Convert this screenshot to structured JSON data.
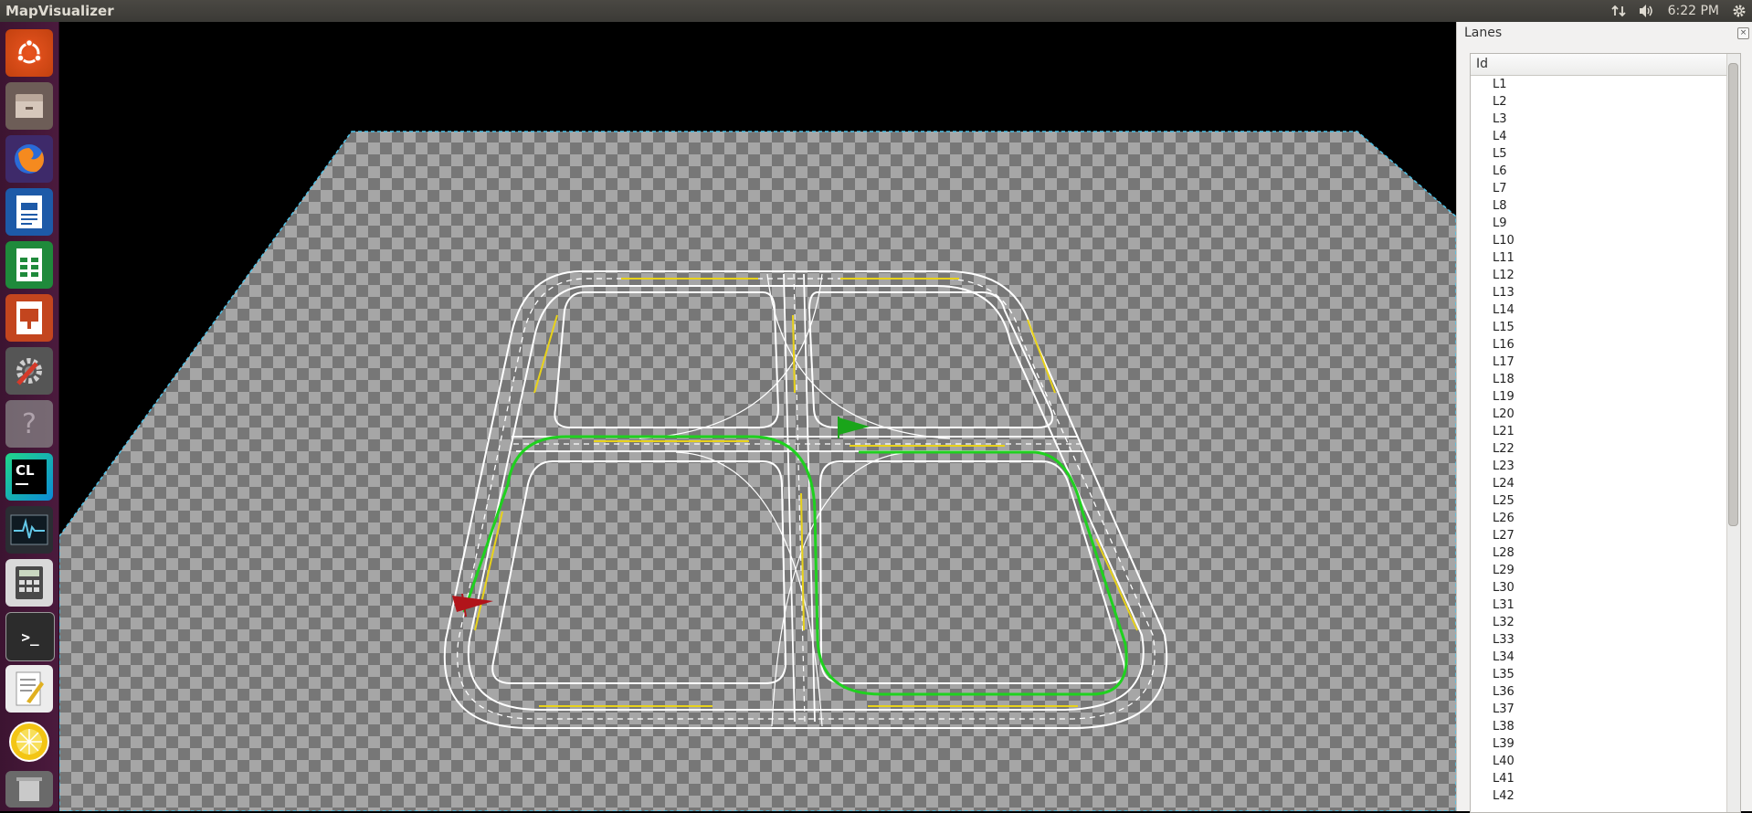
{
  "app": {
    "title": "MapVisualizer"
  },
  "tray": {
    "network_icon": "network-updown-icon",
    "volume_icon": "volume-icon",
    "time": "6:22 PM",
    "settings_icon": "gear-icon"
  },
  "launcher": {
    "items": [
      {
        "name": "ubuntu-dash-icon"
      },
      {
        "name": "files-icon"
      },
      {
        "name": "firefox-icon"
      },
      {
        "name": "writer-icon"
      },
      {
        "name": "calc-icon"
      },
      {
        "name": "impress-icon"
      },
      {
        "name": "system-settings-icon"
      },
      {
        "name": "help-icon"
      },
      {
        "name": "clion-icon",
        "label": "CL"
      },
      {
        "name": "system-monitor-icon"
      },
      {
        "name": "calculator-icon"
      },
      {
        "name": "terminal-icon",
        "label": ">_"
      },
      {
        "name": "text-editor-icon"
      },
      {
        "name": "lemon-app-icon"
      },
      {
        "name": "trash-icon"
      }
    ]
  },
  "colors": {
    "road": "#ffffff",
    "center_line": "#e8d21a",
    "route": "#1fd11f",
    "start_flag": "#1aa51a",
    "end_flag": "#b1141a",
    "checker_light": "#a6a6a6",
    "checker_dark": "#777777",
    "grid_edge": "#4fc3e8"
  },
  "panel": {
    "title": "Lanes",
    "column": "Id",
    "lanes": [
      "L1",
      "L2",
      "L3",
      "L4",
      "L5",
      "L6",
      "L7",
      "L8",
      "L9",
      "L10",
      "L11",
      "L12",
      "L13",
      "L14",
      "L15",
      "L16",
      "L17",
      "L18",
      "L19",
      "L20",
      "L21",
      "L22",
      "L23",
      "L24",
      "L25",
      "L26",
      "L27",
      "L28",
      "L29",
      "L30",
      "L31",
      "L32",
      "L33",
      "L34",
      "L35",
      "L36",
      "L37",
      "L38",
      "L39",
      "L40",
      "L41",
      "L42"
    ]
  }
}
